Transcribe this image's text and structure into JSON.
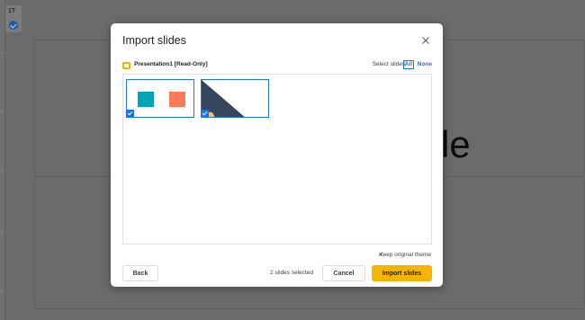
{
  "editor": {
    "tool_label": "1T",
    "slide_title_fragment": "le"
  },
  "dialog": {
    "title": "Import slides",
    "close_icon": "close-icon",
    "source": {
      "name": "Presentation1 [Read-Only]",
      "icon": "slides-icon"
    },
    "select": {
      "label": "Select slides:",
      "all_label": "All",
      "none_label": "None"
    },
    "slides": [
      {
        "index": 1,
        "selected": true,
        "shapes": [
          "teal-square",
          "orange-square"
        ]
      },
      {
        "index": 2,
        "selected": true,
        "shapes": [
          "navy-triangle"
        ]
      }
    ],
    "keep_theme": {
      "checked": true,
      "label": "Keep original theme"
    },
    "footer": {
      "back_label": "Back",
      "count_text": "2 slides selected",
      "cancel_label": "Cancel",
      "import_label": "Import slides"
    }
  },
  "colors": {
    "accent_blue": "#1a73e8",
    "import_yellow": "#f4b400",
    "teal": "#00a3b8",
    "orange": "#ff7a59",
    "navy": "#34455c",
    "overlay": "#6b6b6b"
  }
}
